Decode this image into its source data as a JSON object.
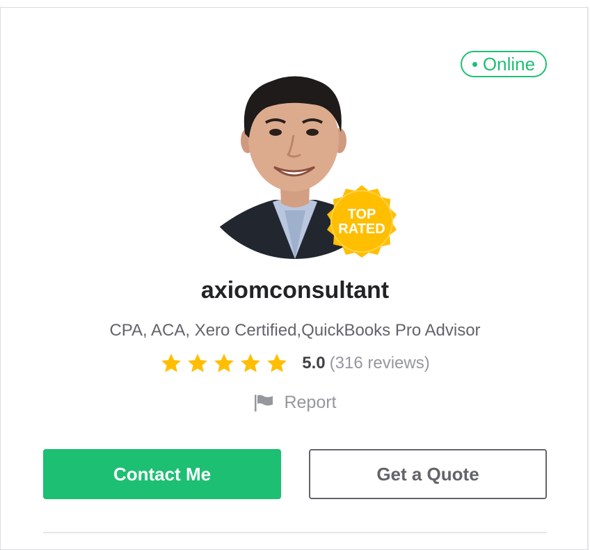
{
  "status": {
    "label": "Online",
    "color": "#1dbf73"
  },
  "profile": {
    "username": "axiomconsultant",
    "tagline": "CPA, ACA, Xero Certified,QuickBooks Pro Advisor",
    "badge_line1": "TOP",
    "badge_line2": "RATED"
  },
  "rating": {
    "stars": 5,
    "score": "5.0",
    "reviews_text": "(316 reviews)",
    "star_color": "#ffbe00"
  },
  "report": {
    "label": "Report",
    "icon": "flag-icon"
  },
  "actions": {
    "contact_label": "Contact Me",
    "quote_label": "Get a Quote"
  },
  "colors": {
    "accent": "#1dbf73",
    "text": "#222325",
    "muted": "#95979d",
    "badge": "#ffbe00"
  }
}
